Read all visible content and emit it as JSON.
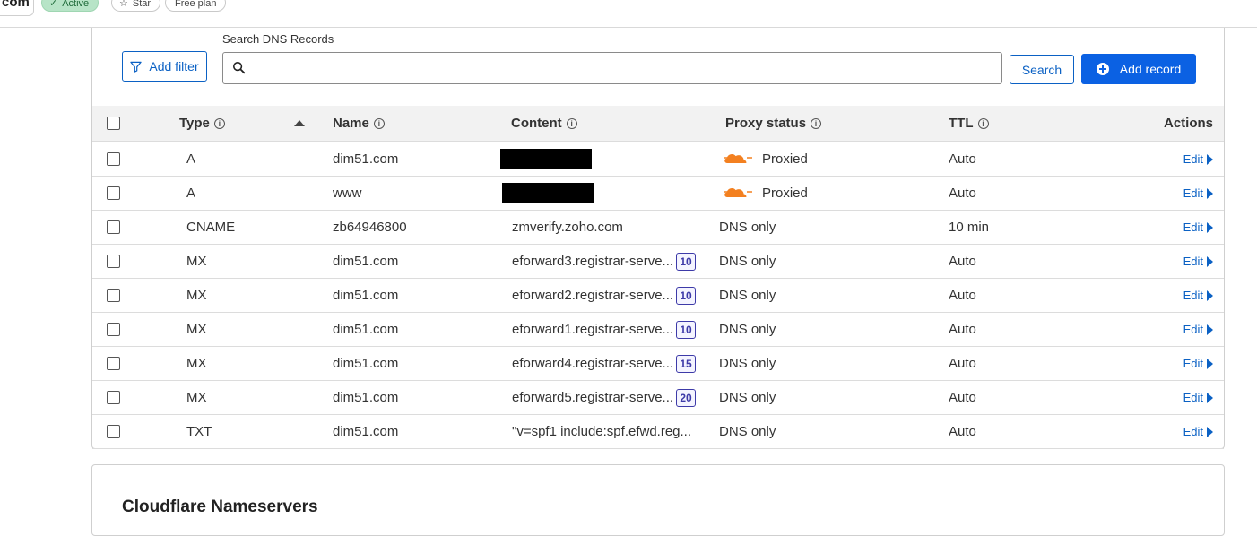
{
  "header": {
    "domain_fragment": "com",
    "status_badge": "Active",
    "star_label": "Star",
    "plan_label": "Free plan"
  },
  "toolbar": {
    "filter_label": "Add filter",
    "search_label": "Search DNS Records",
    "search_value": "",
    "search_placeholder": "",
    "search_button": "Search",
    "add_record_button": "Add record"
  },
  "table": {
    "columns": {
      "type": "Type",
      "name": "Name",
      "content": "Content",
      "proxy": "Proxy status",
      "ttl": "TTL",
      "actions": "Actions"
    },
    "edit_label": "Edit",
    "rows": [
      {
        "type": "A",
        "name": "dim51.com",
        "content": "",
        "redacted": true,
        "priority": "",
        "proxy": "Proxied",
        "proxied": true,
        "ttl": "Auto"
      },
      {
        "type": "A",
        "name": "www",
        "content": "",
        "redacted": true,
        "priority": "",
        "proxy": "Proxied",
        "proxied": true,
        "ttl": "Auto"
      },
      {
        "type": "CNAME",
        "name": "zb64946800",
        "content": "zmverify.zoho.com",
        "redacted": false,
        "priority": "",
        "proxy": "DNS only",
        "proxied": false,
        "ttl": "10 min"
      },
      {
        "type": "MX",
        "name": "dim51.com",
        "content": "eforward3.registrar-serve...",
        "redacted": false,
        "priority": "10",
        "proxy": "DNS only",
        "proxied": false,
        "ttl": "Auto"
      },
      {
        "type": "MX",
        "name": "dim51.com",
        "content": "eforward2.registrar-serve...",
        "redacted": false,
        "priority": "10",
        "proxy": "DNS only",
        "proxied": false,
        "ttl": "Auto"
      },
      {
        "type": "MX",
        "name": "dim51.com",
        "content": "eforward1.registrar-serve...",
        "redacted": false,
        "priority": "10",
        "proxy": "DNS only",
        "proxied": false,
        "ttl": "Auto"
      },
      {
        "type": "MX",
        "name": "dim51.com",
        "content": "eforward4.registrar-serve...",
        "redacted": false,
        "priority": "15",
        "proxy": "DNS only",
        "proxied": false,
        "ttl": "Auto"
      },
      {
        "type": "MX",
        "name": "dim51.com",
        "content": "eforward5.registrar-serve...",
        "redacted": false,
        "priority": "20",
        "proxy": "DNS only",
        "proxied": false,
        "ttl": "Auto"
      },
      {
        "type": "TXT",
        "name": "dim51.com",
        "content": "\"v=spf1 include:spf.efwd.reg...",
        "redacted": false,
        "priority": "",
        "proxy": "DNS only",
        "proxied": false,
        "ttl": "Auto"
      }
    ]
  },
  "nameservers": {
    "title": "Cloudflare Nameservers"
  },
  "colors": {
    "accent": "#0b61c4",
    "primary_button": "#0b61e3",
    "cloud_orange": "#f38020",
    "active_badge": "#b7e4c7"
  },
  "icons": [
    "check-icon",
    "star-icon",
    "filter-icon",
    "search-icon",
    "plus-circle-icon",
    "info-icon",
    "sort-up-icon",
    "cloud-proxied-icon",
    "edit-arrow-icon"
  ]
}
